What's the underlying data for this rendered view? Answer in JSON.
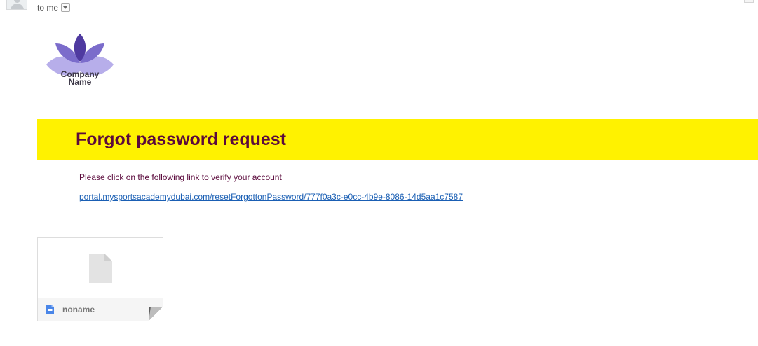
{
  "header": {
    "recipient_label": "to me"
  },
  "logo": {
    "line1": "Company",
    "line2": "Name",
    "colors": {
      "petal_dark": "#4f3aa0",
      "petal_mid": "#7b6ccb",
      "petal_light": "#b7aeea",
      "text": "#3b3646"
    }
  },
  "email": {
    "title": "Forgot password request",
    "instruction": "Please click on the following link to verify your account",
    "link_text": "portal.mysportsacademydubai.com/resetForgottonPassword/777f0a3c-e0cc-4b9e-8086-14d5aa1c7587",
    "colors": {
      "banner_bg": "#fff200",
      "title": "#5b0a3c",
      "link": "#1a5fb4"
    }
  },
  "attachment": {
    "file_name": "noname",
    "preview_icon": "generic-file-icon",
    "type_icon": "google-docs-file-icon"
  }
}
